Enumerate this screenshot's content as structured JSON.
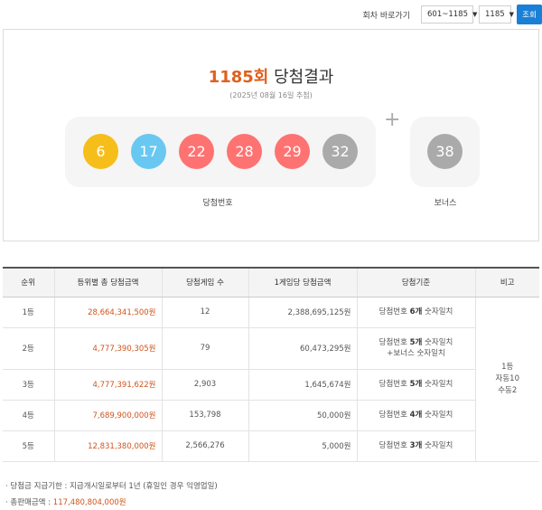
{
  "nav": {
    "label": "회차 바로가기",
    "range_value": "601~1185",
    "round_value": "1185",
    "submit_label": "조회"
  },
  "result": {
    "round_number": "1185회",
    "title_suffix": "당첨결과",
    "draw_date": "(2025년 08월 16일 추첨)",
    "numbers": [
      {
        "value": "6",
        "color": "#f6be1a"
      },
      {
        "value": "17",
        "color": "#69c8f2"
      },
      {
        "value": "22",
        "color": "#ff7272"
      },
      {
        "value": "28",
        "color": "#ff7272"
      },
      {
        "value": "29",
        "color": "#ff7272"
      },
      {
        "value": "32",
        "color": "#aaaaaa"
      }
    ],
    "bonus": {
      "value": "38",
      "color": "#aaaaaa"
    },
    "plus": "+",
    "numbers_label": "당첨번호",
    "bonus_label": "보너스"
  },
  "table": {
    "headers": [
      "순위",
      "등위별 총 당첨금액",
      "당첨게임 수",
      "1게임당 당첨금액",
      "당첨기준",
      "비고"
    ],
    "rows": [
      {
        "rank": "1등",
        "total": "28,664,341,500원",
        "games": "12",
        "per_game": "2,388,695,125원",
        "crit_pre": "당첨번호 ",
        "crit_bold": "6개",
        "crit_post": " 숫자일치",
        "crit_line2": ""
      },
      {
        "rank": "2등",
        "total": "4,777,390,305원",
        "games": "79",
        "per_game": "60,473,295원",
        "crit_pre": "당첨번호 ",
        "crit_bold": "5개",
        "crit_post": " 숫자일치",
        "crit_line2": "+보너스 숫자일치"
      },
      {
        "rank": "3등",
        "total": "4,777,391,622원",
        "games": "2,903",
        "per_game": "1,645,674원",
        "crit_pre": "당첨번호 ",
        "crit_bold": "5개",
        "crit_post": " 숫자일치",
        "crit_line2": ""
      },
      {
        "rank": "4등",
        "total": "7,689,900,000원",
        "games": "153,798",
        "per_game": "50,000원",
        "crit_pre": "당첨번호 ",
        "crit_bold": "4개",
        "crit_post": " 숫자일치",
        "crit_line2": ""
      },
      {
        "rank": "5등",
        "total": "12,831,380,000원",
        "games": "2,566,276",
        "per_game": "5,000원",
        "crit_pre": "당첨번호 ",
        "crit_bold": "3개",
        "crit_post": " 숫자일치",
        "crit_line2": ""
      }
    ],
    "note_lines": [
      "1등",
      "자동10",
      "수동2"
    ]
  },
  "footer": {
    "deadline_text": "· 당첨금 지급기한 : 지급개시일로부터 1년 (휴일인 경우 익영업일)",
    "sales_label": "· 총판매금액 : ",
    "sales_value": "117,480,804,000원"
  }
}
